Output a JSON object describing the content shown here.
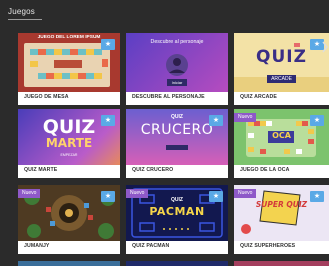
{
  "section": {
    "title": "Juegos"
  },
  "cards": [
    {
      "label": "JUEGO DE MESA",
      "badge": "",
      "thumb_text": "JUEGO DEL LOREM IPSUM"
    },
    {
      "label": "DESCUBRE AL PERSONAJE",
      "badge": "",
      "thumb_text": "Descubre al personaje",
      "thumb_button": "Iniciar"
    },
    {
      "label": "QUIZ ARCADE",
      "badge": "",
      "thumb_text": "QUIZ",
      "thumb_sub": "ARCADE"
    },
    {
      "label": "QUIZ MARTE",
      "badge": "",
      "thumb_text": "QUIZ",
      "thumb_sub": "MARTE",
      "thumb_small": "EMPEZAR"
    },
    {
      "label": "QUIZ CRUCERO",
      "badge": "",
      "thumb_text": "CRUCERO",
      "thumb_sub": "QUIZ"
    },
    {
      "label": "JUEGO DE LA OCA",
      "badge": "Nuevo",
      "thumb_text": "OCA"
    },
    {
      "label": "JUMANJY",
      "badge": "Nuevo",
      "thumb_text": ""
    },
    {
      "label": "QUIZ PACMAN",
      "badge": "Nuevo",
      "thumb_text": "PACMAN",
      "thumb_sub": "QUIZ"
    },
    {
      "label": "QUIZ SUPERHEROES",
      "badge": "Nuevo",
      "thumb_text": "SUPER QUIZ"
    }
  ],
  "colors": {
    "background": "#2b2b2b",
    "favorite_badge": "#5aa9e6",
    "new_badge": "#8e59c8"
  },
  "icons": {
    "favorite": "star-icon",
    "scroll": "chevron-right-icon"
  }
}
